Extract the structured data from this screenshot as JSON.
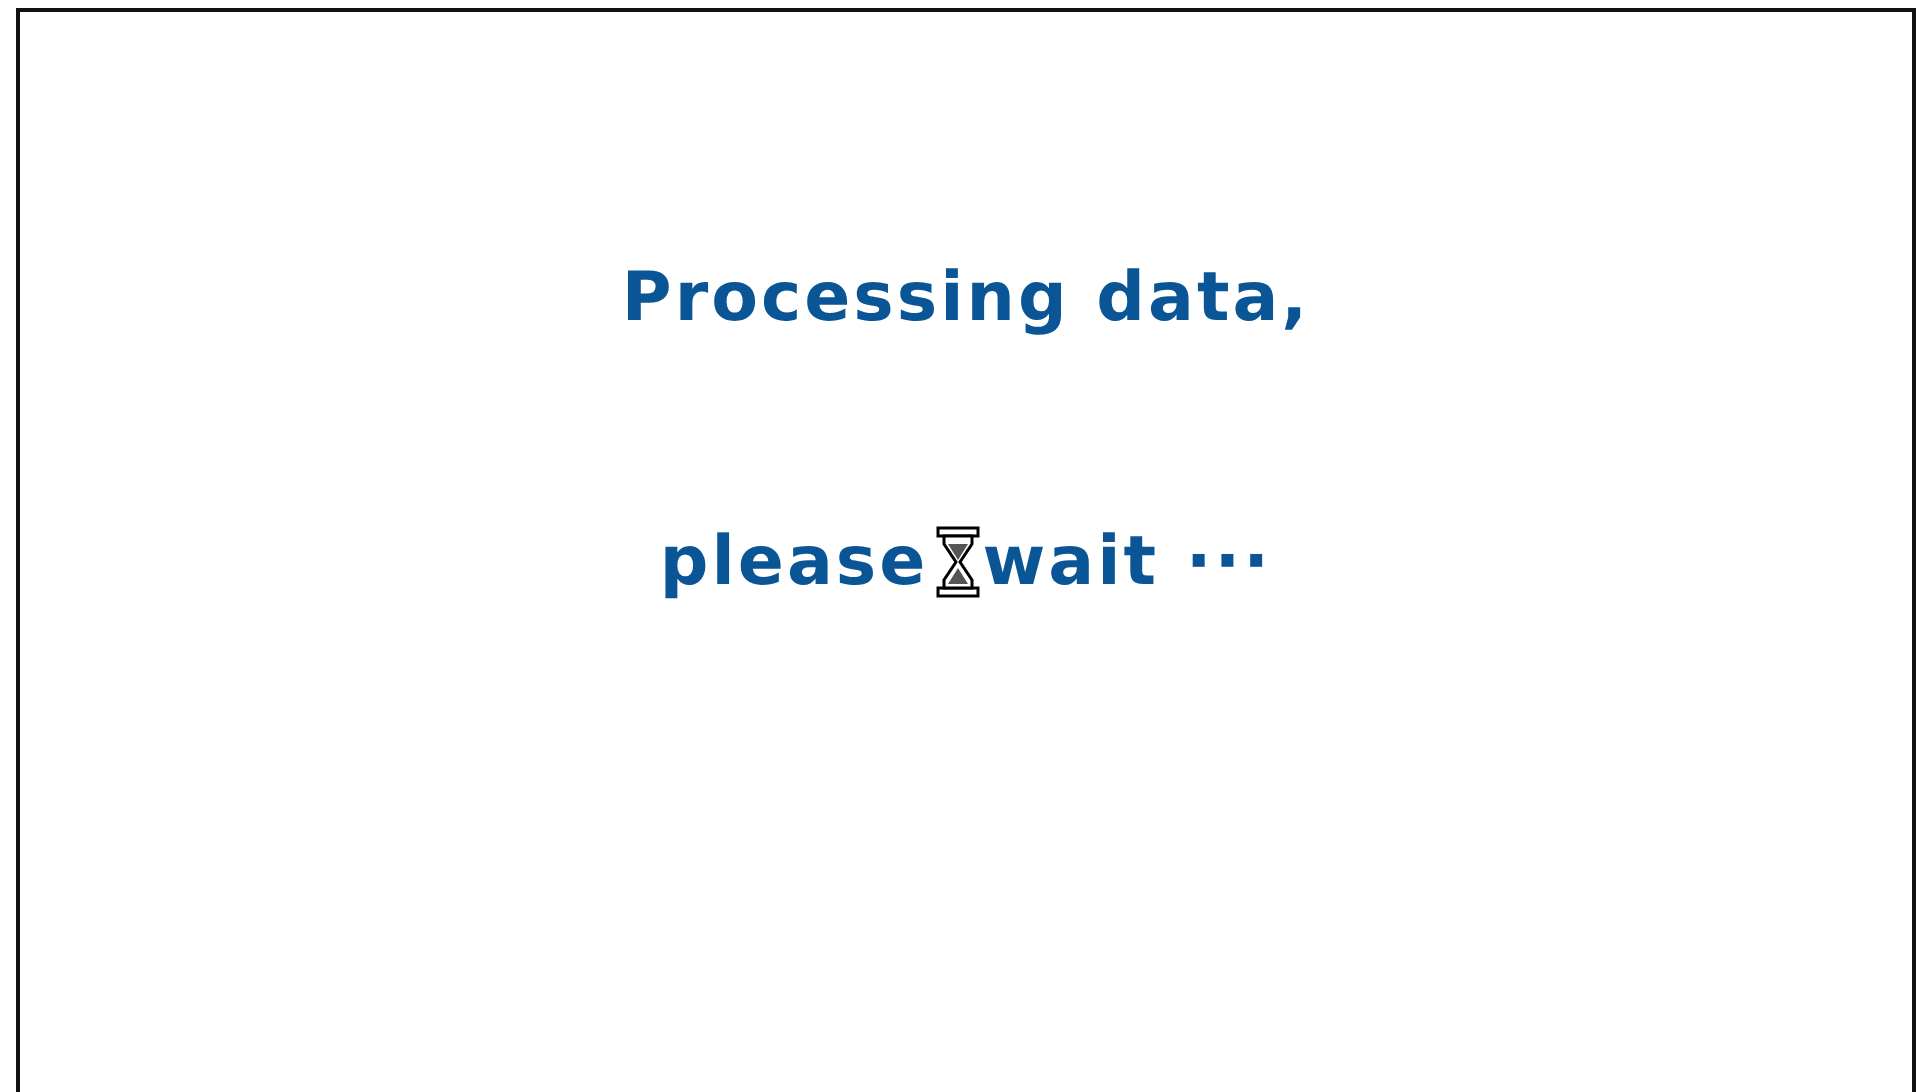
{
  "message": {
    "line_1": "Processing data,",
    "line_2_start": "please",
    "line_2_end": "wait ···"
  }
}
